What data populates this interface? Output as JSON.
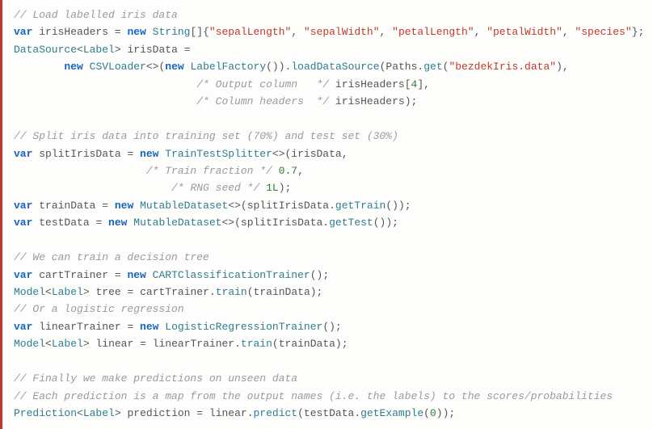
{
  "code": {
    "c1": "// Load labelled iris data",
    "kw_var": "var",
    "kw_new": "new",
    "id_irisHeaders": "irisHeaders",
    "eq": " = ",
    "ty_String": "String",
    "brkt_open": "[]{",
    "s_sepalLength": "\"sepalLength\"",
    "s_sepalWidth": "\"sepalWidth\"",
    "s_petalLength": "\"petalLength\"",
    "s_petalWidth": "\"petalWidth\"",
    "s_species": "\"species\"",
    "brkt_close": "};",
    "comma": ", ",
    "ty_DataSource": "DataSource",
    "ty_Label": "Label",
    "lt": "<",
    "gt": ">",
    "id_irisData": "irisData",
    "eq2": " =",
    "indent_new": "        ",
    "ty_CSVLoader": "CSVLoader",
    "diamond": "<>",
    "paren_open": "(",
    "paren_close": ")",
    "ty_LabelFactory": "LabelFactory",
    "empty_parens": "()",
    "dot": ".",
    "fn_loadDataSource": "loadDataSource",
    "id_Paths": "Paths",
    "fn_get": "get",
    "s_bezdek": "\"bezdekIris.data\"",
    "paren_close_comma": "),",
    "pad_outcol": "                             ",
    "c_outcol": "/* Output column   */",
    "sp": " ",
    "arr4": "irisHeaders[",
    "num4": "4",
    "arr4_close": "],",
    "c_colhdr": "/* Column headers  */",
    "id_irisHeaders2": "irisHeaders);",
    "blank": "",
    "c2": "// Split iris data into training set (70%) and test set (30%)",
    "id_splitIrisData": "splitIrisData",
    "ty_TrainTestSplitter": "TrainTestSplitter",
    "open_irisData": "(irisData,",
    "pad_tf": "                     ",
    "c_tf": "/* Train fraction */",
    "num07": "0.7",
    "comma_only": ",",
    "pad_rng": "                         ",
    "c_rng": "/* RNG seed */",
    "num1L": "1L",
    "close_stmt": ");",
    "id_trainData": "trainData",
    "ty_MutableDataset": "MutableDataset",
    "open_split": "(splitIrisData.",
    "fn_getTrain": "getTrain",
    "close_call": "());",
    "id_testData": "testData",
    "fn_getTest": "getTest",
    "c3": "// We can train a decision tree",
    "id_cartTrainer": "cartTrainer",
    "ty_CART": "CARTClassificationTrainer",
    "semi_empty": "();",
    "ty_Model": "Model",
    "id_tree": "tree",
    "eq_sp": " = ",
    "id_cartTrainer2": "cartTrainer.",
    "fn_train": "train",
    "args_trainData": "(trainData);",
    "c4": "// Or a logistic regression",
    "id_linearTrainer": "linearTrainer",
    "ty_Logistic": "LogisticRegressionTrainer",
    "id_linear": "linear",
    "id_linearTrainer2": "linearTrainer.",
    "c5": "// Finally we make predictions on unseen data",
    "c6": "// Each prediction is a map from the output names (i.e. the labels) to the scores/probabilities",
    "ty_Prediction": "Prediction",
    "id_prediction": "prediction",
    "id_linear2": "linear.",
    "fn_predict": "predict",
    "open_testData": "(testData.",
    "fn_getExample": "getExample",
    "args_0_open": "(",
    "num0": "0",
    "args_0_close": "));"
  }
}
